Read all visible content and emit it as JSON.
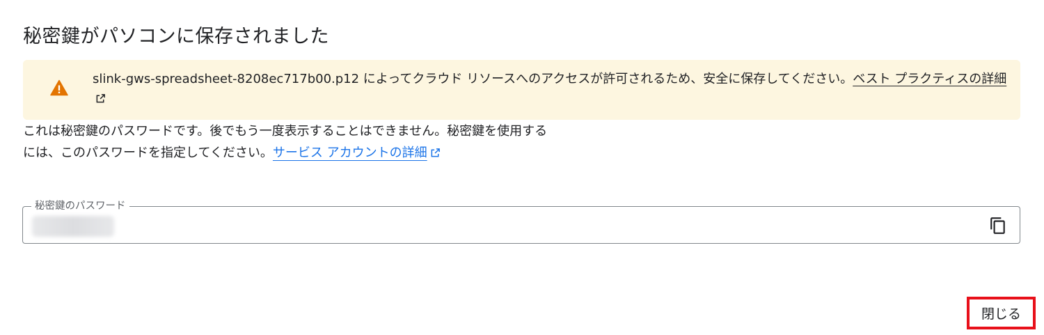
{
  "dialog": {
    "title": "秘密鍵がパソコンに保存されました"
  },
  "warning": {
    "icon": "warning-icon",
    "text": "slink-gws-spreadsheet-8208ec717b00.p12 によってクラウド リソースへのアクセスが許可されるため、安全に保存してください。",
    "link_label": "ベスト プラクティスの詳細",
    "link_icon": "open-in-new-icon"
  },
  "description": {
    "text": "これは秘密鍵のパスワードです。後でもう一度表示することはできません。秘密鍵を使用するには、このパスワードを指定してください。",
    "link_label": "サービス アカウントの詳細",
    "link_color": "#1a73e8",
    "link_icon": "open-in-new-icon"
  },
  "password_field": {
    "label": "秘密鍵のパスワード",
    "value": "",
    "copy_icon": "copy-icon"
  },
  "actions": {
    "close_label": "閉じる",
    "highlight_color": "#e8101a"
  },
  "colors": {
    "warning_bg": "#fdf6e0",
    "warning_icon": "#e37400"
  }
}
